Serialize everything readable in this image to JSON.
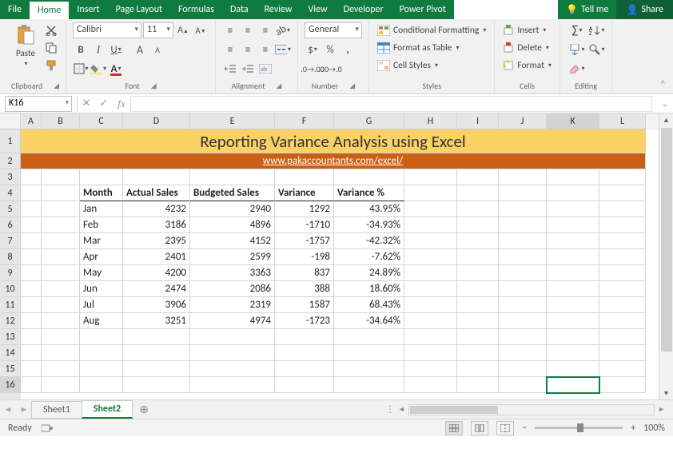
{
  "tabs": {
    "file": "File",
    "home": "Home",
    "insert": "Insert",
    "page": "Page Layout",
    "formulas": "Formulas",
    "data": "Data",
    "review": "Review",
    "view": "View",
    "developer": "Developer",
    "powerpivot": "Power Pivot",
    "tellme": "Tell me",
    "share": "Share"
  },
  "ribbon": {
    "clipboard": {
      "label": "Clipboard",
      "paste": "Paste"
    },
    "font": {
      "label": "Font",
      "name": "Calibri",
      "size": "11"
    },
    "alignment": {
      "label": "Alignment"
    },
    "number": {
      "label": "Number",
      "format": "General"
    },
    "styles": {
      "label": "Styles",
      "cond": "Conditional Formatting",
      "table": "Format as Table",
      "cell": "Cell Styles"
    },
    "cells": {
      "label": "Cells",
      "insert": "Insert",
      "delete": "Delete",
      "format": "Format"
    },
    "editing": {
      "label": "Editing"
    }
  },
  "formula_bar": {
    "name_box": "K16",
    "fx": "fx"
  },
  "columns": [
    "",
    "A",
    "B",
    "C",
    "D",
    "E",
    "F",
    "G",
    "H",
    "I",
    "J",
    "K",
    "L"
  ],
  "title": "Reporting Variance Analysis using Excel",
  "link": "www.pakaccountants.com/excel/",
  "table": {
    "headers": [
      "Month",
      "Actual Sales",
      "Budgeted Sales",
      "Variance",
      "Variance %"
    ],
    "rows": [
      [
        "Jan",
        "4232",
        "2940",
        "1292",
        "43.95%"
      ],
      [
        "Feb",
        "3186",
        "4896",
        "-1710",
        "-34.93%"
      ],
      [
        "Mar",
        "2395",
        "4152",
        "-1757",
        "-42.32%"
      ],
      [
        "Apr",
        "2401",
        "2599",
        "-198",
        "-7.62%"
      ],
      [
        "May",
        "4200",
        "3363",
        "837",
        "24.89%"
      ],
      [
        "Jun",
        "2474",
        "2086",
        "388",
        "18.60%"
      ],
      [
        "Jul",
        "3906",
        "2319",
        "1587",
        "68.43%"
      ],
      [
        "Aug",
        "3251",
        "4974",
        "-1723",
        "-34.64%"
      ]
    ]
  },
  "selected_cell": "K16",
  "sheets": {
    "s1": "Sheet1",
    "s2": "Sheet2"
  },
  "status": {
    "ready": "Ready",
    "zoom": "100%"
  }
}
